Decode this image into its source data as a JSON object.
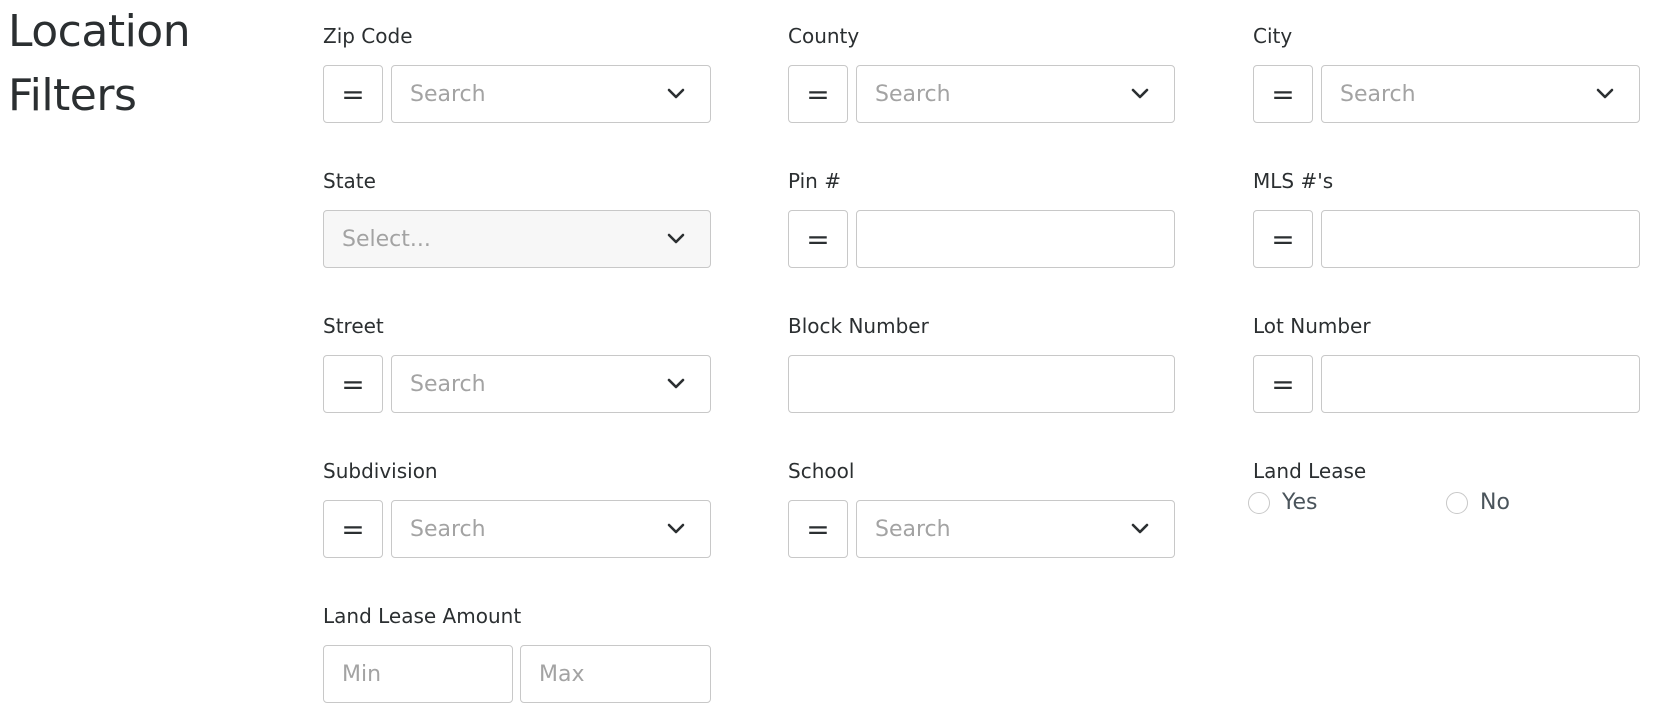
{
  "section_title": "Location Filters",
  "operator_symbol": "=",
  "fields": {
    "zip_code": {
      "label": "Zip Code",
      "placeholder": "Search"
    },
    "county": {
      "label": "County",
      "placeholder": "Search"
    },
    "city": {
      "label": "City",
      "placeholder": "Search"
    },
    "state": {
      "label": "State",
      "placeholder": "Select..."
    },
    "pin": {
      "label": "Pin #",
      "value": ""
    },
    "mls": {
      "label": "MLS #'s",
      "value": ""
    },
    "street": {
      "label": "Street",
      "placeholder": "Search"
    },
    "block_number": {
      "label": "Block Number",
      "value": ""
    },
    "lot_number": {
      "label": "Lot Number",
      "value": ""
    },
    "subdivision": {
      "label": "Subdivision",
      "placeholder": "Search"
    },
    "school": {
      "label": "School",
      "placeholder": "Search"
    },
    "land_lease": {
      "label": "Land Lease",
      "options": [
        "Yes",
        "No"
      ]
    },
    "land_lease_amount": {
      "label": "Land Lease Amount",
      "min_placeholder": "Min",
      "max_placeholder": "Max"
    }
  },
  "icons": {
    "chevron": "chevron-down-icon"
  },
  "colors": {
    "border": "#c8c8c8",
    "placeholder": "#a3a3a3",
    "text": "#2b2f31",
    "disabled_bg": "#f7f7f7"
  }
}
